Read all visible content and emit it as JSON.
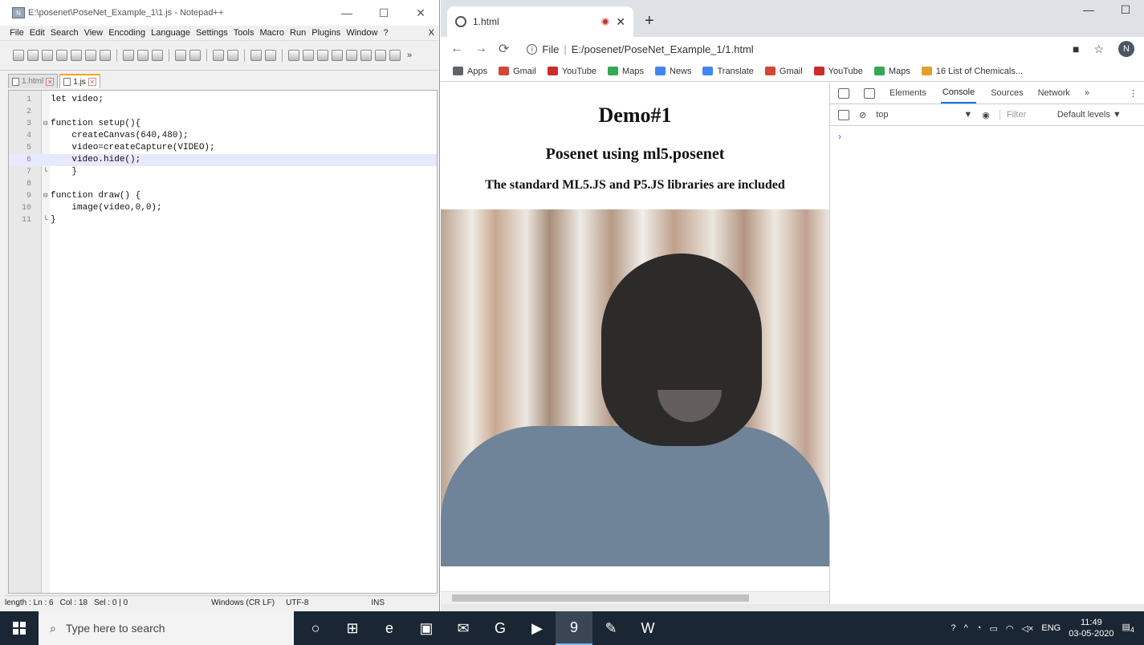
{
  "notepad": {
    "title": "E:\\posenet\\PoseNet_Example_1\\1.js - Notepad++",
    "window_controls": [
      "—",
      "☐",
      "✕"
    ],
    "menu": [
      "File",
      "Edit",
      "Search",
      "View",
      "Encoding",
      "Language",
      "Settings",
      "Tools",
      "Macro",
      "Run",
      "Plugins",
      "Window",
      "?"
    ],
    "menu_close": "X",
    "toolbar_more": "»",
    "tabs": [
      {
        "label": "1.html",
        "active": false
      },
      {
        "label": "1.js",
        "active": true
      }
    ],
    "lines": [
      {
        "n": "1",
        "code": "let video;"
      },
      {
        "n": "2",
        "code": ""
      },
      {
        "n": "3",
        "code": "function setup(){",
        "fold": "⊟"
      },
      {
        "n": "4",
        "code": "    createCanvas(640,480);"
      },
      {
        "n": "5",
        "code": "    video=createCapture(VIDEO);"
      },
      {
        "n": "6",
        "code": "    video.hide();",
        "current": true
      },
      {
        "n": "7",
        "code": "    }",
        "fold": "└"
      },
      {
        "n": "8",
        "code": ""
      },
      {
        "n": "9",
        "code": "function draw() {",
        "fold": "⊟"
      },
      {
        "n": "10",
        "code": "    image(video,0,0);"
      },
      {
        "n": "11",
        "code": "}",
        "fold": "└"
      }
    ],
    "status": {
      "length": "length : Ln : 6",
      "col": "Col : 18",
      "sel": "Sel : 0 | 0",
      "eol": "Windows (CR LF)",
      "enc": "UTF-8",
      "mode": "INS"
    }
  },
  "chrome": {
    "tab_title": "1.html",
    "close": "✕",
    "newtab": "+",
    "window_controls": [
      "—",
      "☐"
    ],
    "nav": {
      "back": "←",
      "forward": "→",
      "reload": "⟳"
    },
    "url_prefix": "File",
    "url": "E:/posenet/PoseNet_Example_1/1.html",
    "star": "☆",
    "avatar": "N",
    "bookmarks": [
      {
        "label": "Apps",
        "color": "#5f6368"
      },
      {
        "label": "Gmail",
        "color": "#d44638"
      },
      {
        "label": "YouTube",
        "color": "#cc2b2b"
      },
      {
        "label": "Maps",
        "color": "#34a853"
      },
      {
        "label": "News",
        "color": "#4285f4"
      },
      {
        "label": "Translate",
        "color": "#4285f4"
      },
      {
        "label": "Gmail",
        "color": "#d44638"
      },
      {
        "label": "YouTube",
        "color": "#cc2b2b"
      },
      {
        "label": "Maps",
        "color": "#34a853"
      },
      {
        "label": "16 List of Chemicals...",
        "color": "#e0a030"
      }
    ],
    "page": {
      "h1": "Demo#1",
      "h2": "Posenet using ml5.posenet",
      "h3": "The standard ML5.JS and P5.JS libraries are included"
    },
    "devtools": {
      "tabs": [
        "Elements",
        "Console",
        "Sources",
        "Network"
      ],
      "active_tab": "Console",
      "more": "»",
      "kebab": "⋮",
      "context": "top",
      "context_arrow": "▼",
      "filter": "Filter",
      "levels": "Default levels ▼",
      "prompt": "›"
    }
  },
  "taskbar": {
    "search_placeholder": "Type here to search",
    "apps": [
      "○",
      "⊞",
      "e",
      "▣",
      "✉",
      "G",
      "▶",
      "9",
      "✎",
      "W"
    ],
    "tray_lang": "ENG",
    "time": "11:49",
    "date": "03-05-2020",
    "notif": "4"
  }
}
